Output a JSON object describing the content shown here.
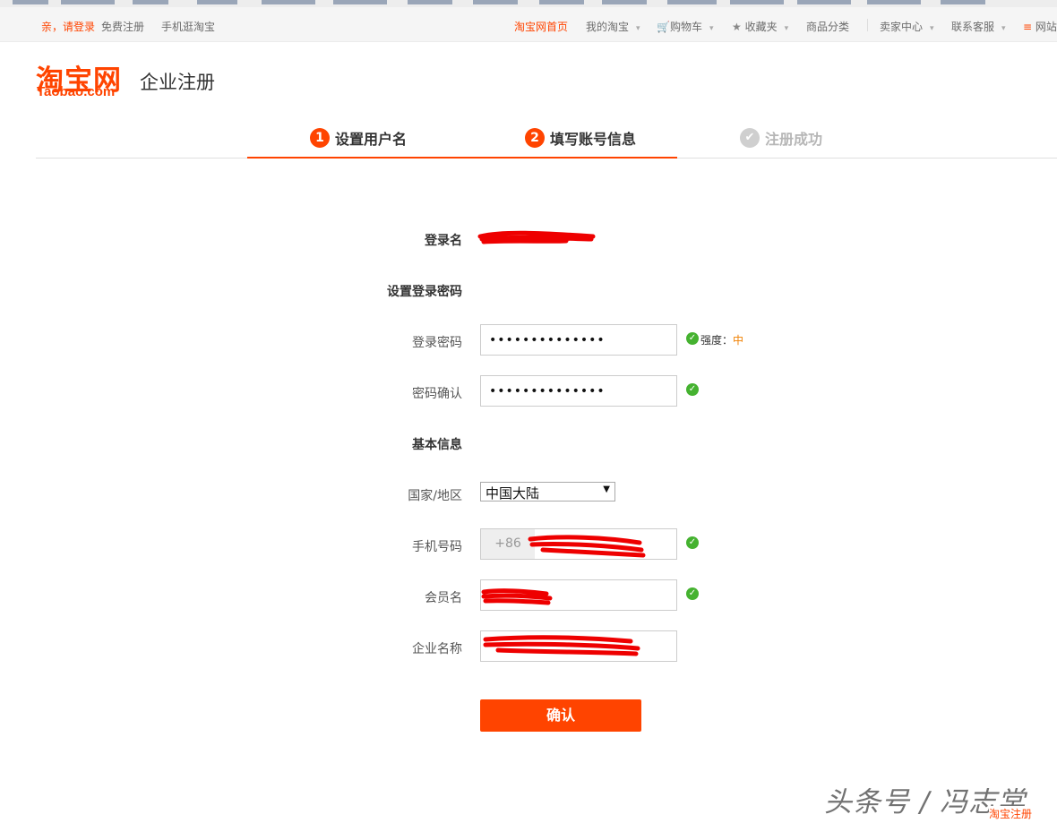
{
  "colors": {
    "brand": "#ff4400",
    "success": "#45b230",
    "strength_mid": "#f08000",
    "redaction": "#ee0000"
  },
  "topbar": {
    "greeting": "亲，请登录",
    "register": "免费注册",
    "mobile": "手机逛淘宝",
    "home": "淘宝网首页",
    "my_taobao": "我的淘宝",
    "cart": "购物车",
    "favorites": "收藏夹",
    "categories": "商品分类",
    "seller": "卖家中心",
    "service": "联系客服",
    "sitemap": "网站导航",
    "cart_icon": "cart-icon",
    "star_icon": "star-icon",
    "menu_icon": "menu-icon"
  },
  "header": {
    "logo_cn": "淘宝网",
    "logo_en": "Taobao.com",
    "subtitle": "企业注册"
  },
  "steps": [
    {
      "num": "1",
      "label": "设置用户名",
      "state": "done"
    },
    {
      "num": "2",
      "label": "填写账号信息",
      "state": "active"
    },
    {
      "icon": "check-circle-icon",
      "label": "注册成功",
      "state": "pending"
    }
  ],
  "form": {
    "login_name_label": "登录名",
    "login_name_value": "（已遮挡）",
    "section_password": "设置登录密码",
    "password_label": "登录密码",
    "password_value": "••••••••••••••",
    "strength_label": "强度：",
    "strength_level": "中",
    "confirm_label": "密码确认",
    "confirm_value": "••••••••••••••",
    "section_basic": "基本信息",
    "region_label": "国家/地区",
    "region_value": "中国大陆",
    "phone_label": "手机号码",
    "phone_prefix": "+86",
    "member_label": "会员名",
    "company_label": "企业名称",
    "submit": "确认"
  },
  "watermark": "头条号 / 冯志棠",
  "corner_tag": "淘宝注册"
}
